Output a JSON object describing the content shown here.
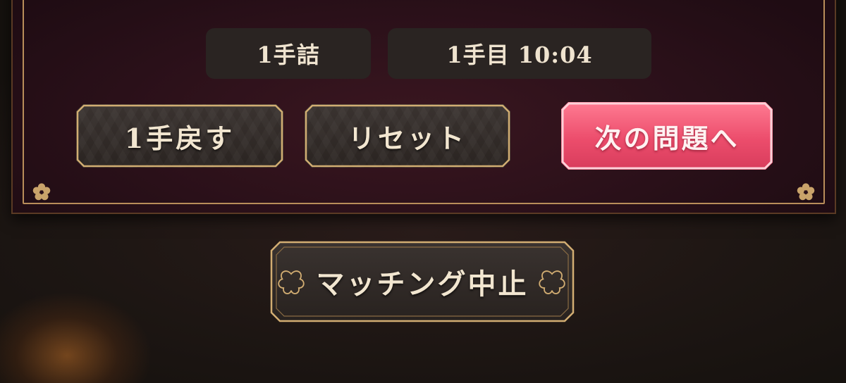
{
  "info": {
    "mate_length": "1手詰",
    "move_timer": "1手目 10:04"
  },
  "actions": {
    "undo_label": "1手戻す",
    "reset_label": "リセット",
    "next_label": "次の問題へ"
  },
  "matching": {
    "stop_label": "マッチング中止"
  },
  "colors": {
    "gold_border": "#c9a36a",
    "accent_pink": "#ec4d6c",
    "panel_bg": "#2a1019",
    "text": "#efe3cf"
  },
  "icons": [
    "sakura-icon"
  ]
}
